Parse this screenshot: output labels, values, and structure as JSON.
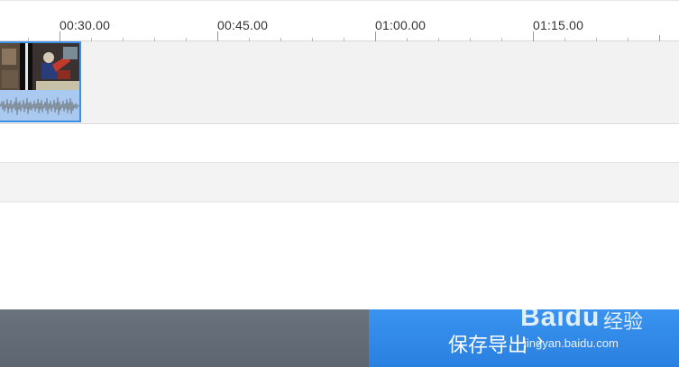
{
  "timeline": {
    "ticks": [
      {
        "label": "00:30.00"
      },
      {
        "label": "00:45.00"
      },
      {
        "label": "01:00.00"
      },
      {
        "label": "01:15.00"
      }
    ]
  },
  "clip": {
    "selected": true,
    "accent_color": "#3d8fe6"
  },
  "footer": {
    "export_label": "保存导出",
    "export_chevron": "›",
    "export_color": "#3a93ef",
    "left_panel_color": "#66707b"
  },
  "watermark": {
    "brand": "Baidu",
    "brand_cn": "经验",
    "url": "jingyan.baidu.com"
  }
}
